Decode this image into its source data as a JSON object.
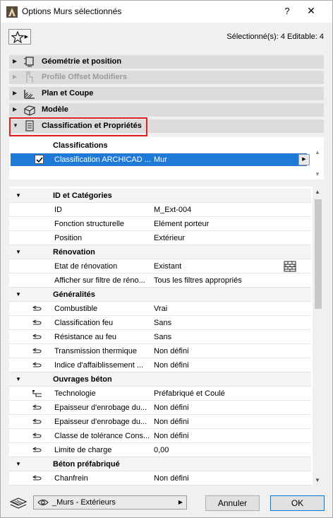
{
  "window": {
    "title": "Options Murs sélectionnés",
    "help": "?",
    "close": "✕"
  },
  "selection_info": "Sélectionné(s): 4 Editable: 4",
  "sections": [
    {
      "label": "Géométrie et position",
      "icon": "geometry-icon",
      "disabled": false
    },
    {
      "label": "Profile Offset Modifiers",
      "icon": "profile-offset-icon",
      "disabled": true
    },
    {
      "label": "Plan et Coupe",
      "icon": "plan-section-icon",
      "disabled": false
    },
    {
      "label": "Modèle",
      "icon": "model-icon",
      "disabled": false
    },
    {
      "label": "Classification et Propriétés",
      "icon": "classification-icon",
      "disabled": false,
      "expanded": true
    }
  ],
  "classifications": {
    "header": "Classifications",
    "rows": [
      {
        "name": "Classification ARCHICAD ...",
        "value": "Mur",
        "checked": true
      }
    ]
  },
  "properties": {
    "groups": [
      {
        "name": "ID et Catégories",
        "items": [
          {
            "name": "ID",
            "value": "M_Ext-004"
          },
          {
            "name": "Fonction structurelle",
            "value": "Elément porteur"
          },
          {
            "name": "Position",
            "value": "Extérieur"
          }
        ]
      },
      {
        "name": "Rénovation",
        "items": [
          {
            "name": "Etat de rénovation",
            "value": "Existant",
            "right_icon": "brick-wall-icon"
          },
          {
            "name": "Afficher sur filtre de réno...",
            "value": "Tous les filtres appropriés"
          }
        ]
      },
      {
        "name": "Généralités",
        "items": [
          {
            "name": "Combustible",
            "value": "Vrai",
            "icon": "link-icon"
          },
          {
            "name": "Classification feu",
            "value": "Sans",
            "icon": "link-icon"
          },
          {
            "name": "Résistance au feu",
            "value": "Sans",
            "icon": "link-icon"
          },
          {
            "name": "Transmission thermique",
            "value": "Non défini",
            "icon": "link-icon"
          },
          {
            "name": "Indice d'affaiblissement ...",
            "value": "Non défini",
            "icon": "link-icon"
          }
        ]
      },
      {
        "name": "Ouvrages béton",
        "items": [
          {
            "name": "Technologie",
            "value": "Préfabriqué et Coulé",
            "icon": "hierarchy-icon"
          },
          {
            "name": "Epaisseur d'enrobage du...",
            "value": "Non défini",
            "icon": "link-icon"
          },
          {
            "name": "Epaisseur d'enrobage du...",
            "value": "Non défini",
            "icon": "link-icon"
          },
          {
            "name": "Classe de tolérance Cons...",
            "value": "Non défini",
            "icon": "link-icon"
          },
          {
            "name": "Limite de charge",
            "value": "0,00",
            "icon": "link-icon"
          }
        ]
      },
      {
        "name": "Béton préfabriqué",
        "items": [
          {
            "name": "Chanfrein",
            "value": "Non défini",
            "icon": "link-icon"
          }
        ]
      }
    ]
  },
  "footer": {
    "layer": "_Murs - Extérieurs",
    "cancel_label": "Annuler",
    "ok_label": "OK"
  },
  "colors": {
    "selection": "#1e7ad6",
    "highlight": "#e01f1f",
    "section_bar": "#dcdcdc"
  }
}
